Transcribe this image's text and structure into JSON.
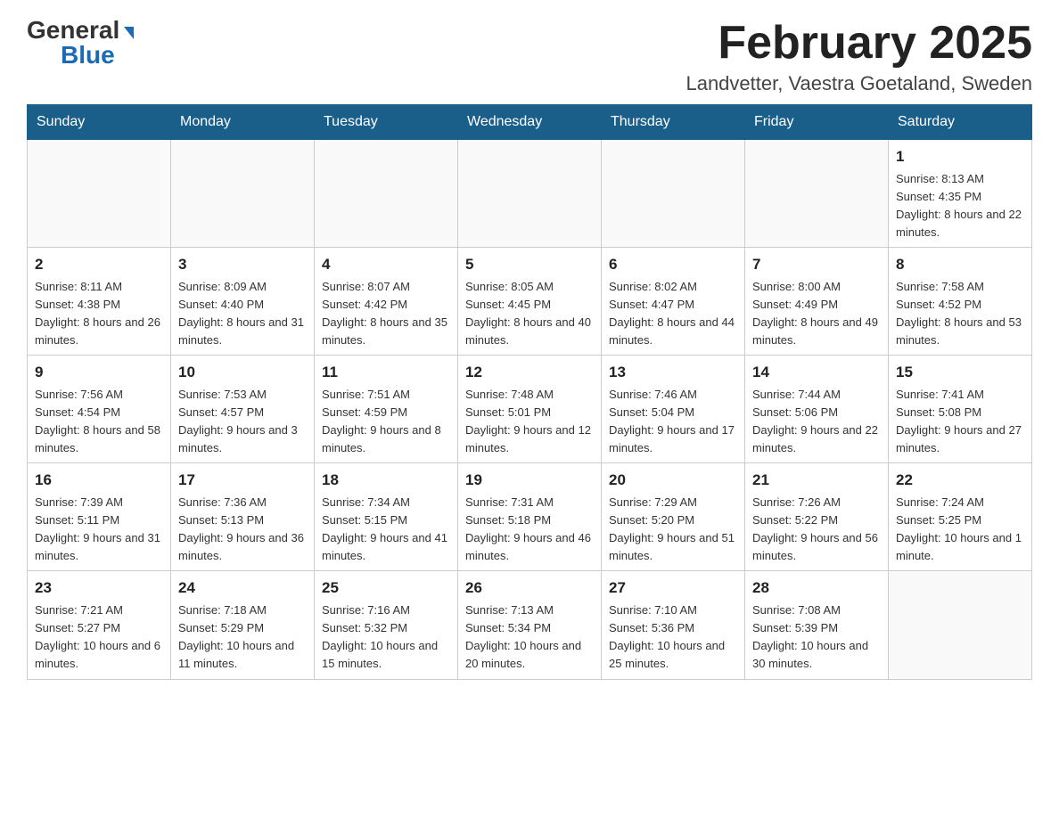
{
  "logo": {
    "general": "General",
    "blue": "Blue",
    "triangle": "▲"
  },
  "header": {
    "month_year": "February 2025",
    "location": "Landvetter, Vaestra Goetaland, Sweden"
  },
  "days_of_week": [
    "Sunday",
    "Monday",
    "Tuesday",
    "Wednesday",
    "Thursday",
    "Friday",
    "Saturday"
  ],
  "weeks": [
    {
      "days": [
        {
          "num": "",
          "info": ""
        },
        {
          "num": "",
          "info": ""
        },
        {
          "num": "",
          "info": ""
        },
        {
          "num": "",
          "info": ""
        },
        {
          "num": "",
          "info": ""
        },
        {
          "num": "",
          "info": ""
        },
        {
          "num": "1",
          "info": "Sunrise: 8:13 AM\nSunset: 4:35 PM\nDaylight: 8 hours and 22 minutes."
        }
      ]
    },
    {
      "days": [
        {
          "num": "2",
          "info": "Sunrise: 8:11 AM\nSunset: 4:38 PM\nDaylight: 8 hours and 26 minutes."
        },
        {
          "num": "3",
          "info": "Sunrise: 8:09 AM\nSunset: 4:40 PM\nDaylight: 8 hours and 31 minutes."
        },
        {
          "num": "4",
          "info": "Sunrise: 8:07 AM\nSunset: 4:42 PM\nDaylight: 8 hours and 35 minutes."
        },
        {
          "num": "5",
          "info": "Sunrise: 8:05 AM\nSunset: 4:45 PM\nDaylight: 8 hours and 40 minutes."
        },
        {
          "num": "6",
          "info": "Sunrise: 8:02 AM\nSunset: 4:47 PM\nDaylight: 8 hours and 44 minutes."
        },
        {
          "num": "7",
          "info": "Sunrise: 8:00 AM\nSunset: 4:49 PM\nDaylight: 8 hours and 49 minutes."
        },
        {
          "num": "8",
          "info": "Sunrise: 7:58 AM\nSunset: 4:52 PM\nDaylight: 8 hours and 53 minutes."
        }
      ]
    },
    {
      "days": [
        {
          "num": "9",
          "info": "Sunrise: 7:56 AM\nSunset: 4:54 PM\nDaylight: 8 hours and 58 minutes."
        },
        {
          "num": "10",
          "info": "Sunrise: 7:53 AM\nSunset: 4:57 PM\nDaylight: 9 hours and 3 minutes."
        },
        {
          "num": "11",
          "info": "Sunrise: 7:51 AM\nSunset: 4:59 PM\nDaylight: 9 hours and 8 minutes."
        },
        {
          "num": "12",
          "info": "Sunrise: 7:48 AM\nSunset: 5:01 PM\nDaylight: 9 hours and 12 minutes."
        },
        {
          "num": "13",
          "info": "Sunrise: 7:46 AM\nSunset: 5:04 PM\nDaylight: 9 hours and 17 minutes."
        },
        {
          "num": "14",
          "info": "Sunrise: 7:44 AM\nSunset: 5:06 PM\nDaylight: 9 hours and 22 minutes."
        },
        {
          "num": "15",
          "info": "Sunrise: 7:41 AM\nSunset: 5:08 PM\nDaylight: 9 hours and 27 minutes."
        }
      ]
    },
    {
      "days": [
        {
          "num": "16",
          "info": "Sunrise: 7:39 AM\nSunset: 5:11 PM\nDaylight: 9 hours and 31 minutes."
        },
        {
          "num": "17",
          "info": "Sunrise: 7:36 AM\nSunset: 5:13 PM\nDaylight: 9 hours and 36 minutes."
        },
        {
          "num": "18",
          "info": "Sunrise: 7:34 AM\nSunset: 5:15 PM\nDaylight: 9 hours and 41 minutes."
        },
        {
          "num": "19",
          "info": "Sunrise: 7:31 AM\nSunset: 5:18 PM\nDaylight: 9 hours and 46 minutes."
        },
        {
          "num": "20",
          "info": "Sunrise: 7:29 AM\nSunset: 5:20 PM\nDaylight: 9 hours and 51 minutes."
        },
        {
          "num": "21",
          "info": "Sunrise: 7:26 AM\nSunset: 5:22 PM\nDaylight: 9 hours and 56 minutes."
        },
        {
          "num": "22",
          "info": "Sunrise: 7:24 AM\nSunset: 5:25 PM\nDaylight: 10 hours and 1 minute."
        }
      ]
    },
    {
      "days": [
        {
          "num": "23",
          "info": "Sunrise: 7:21 AM\nSunset: 5:27 PM\nDaylight: 10 hours and 6 minutes."
        },
        {
          "num": "24",
          "info": "Sunrise: 7:18 AM\nSunset: 5:29 PM\nDaylight: 10 hours and 11 minutes."
        },
        {
          "num": "25",
          "info": "Sunrise: 7:16 AM\nSunset: 5:32 PM\nDaylight: 10 hours and 15 minutes."
        },
        {
          "num": "26",
          "info": "Sunrise: 7:13 AM\nSunset: 5:34 PM\nDaylight: 10 hours and 20 minutes."
        },
        {
          "num": "27",
          "info": "Sunrise: 7:10 AM\nSunset: 5:36 PM\nDaylight: 10 hours and 25 minutes."
        },
        {
          "num": "28",
          "info": "Sunrise: 7:08 AM\nSunset: 5:39 PM\nDaylight: 10 hours and 30 minutes."
        },
        {
          "num": "",
          "info": ""
        }
      ]
    }
  ]
}
